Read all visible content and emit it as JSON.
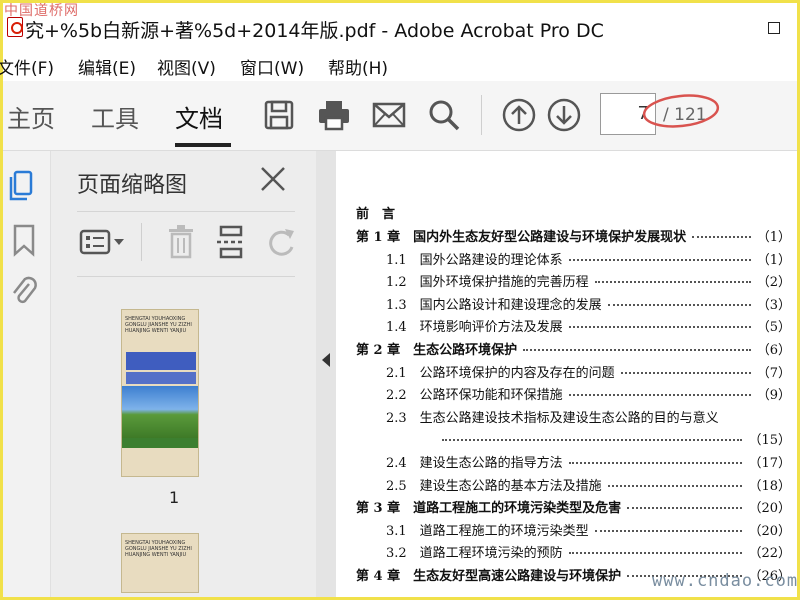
{
  "watermark_top": "中国道桥网",
  "window": {
    "title": "究+%5b白新源+著%5d+2014年版.pdf - Adobe Acrobat Pro DC"
  },
  "menu": {
    "items": [
      "文件(F)",
      "编辑(E)",
      "视图(V)",
      "窗口(W)",
      "帮助(H)"
    ]
  },
  "toolbar": {
    "tabs": [
      "主页",
      "工具",
      "文档"
    ],
    "active_tab": "文档",
    "icons": [
      "save-icon",
      "print-icon",
      "email-icon",
      "search-icon",
      "arrow-up-icon",
      "arrow-down-icon"
    ],
    "page_current": "7",
    "page_total": "/ 121"
  },
  "thumbnail_panel": {
    "title": "页面缩略图",
    "thumb1_text": "SHENGTAI YOUHAOXING GONGLU JIANSHE YU ZIZHI HUANJING WENTI YANJIU",
    "thumb1_title_cn": "生态友好型公路建设与环境保护",
    "thumb1_page": "1",
    "thumb2_text": "SHENGTAI YOUHAOXING GONGLU JIANSHE YU ZIZHI HUANJING WENTI YANJIU"
  },
  "toc": {
    "header": "前　言",
    "entries": [
      {
        "label": "第 1 章　国内外生态友好型公路建设与环境保护发展现状",
        "page": "（1）",
        "bold": true,
        "indent": 0
      },
      {
        "label": "1.1　国外公路建设的理论体系",
        "page": "（1）",
        "bold": false,
        "indent": 1
      },
      {
        "label": "1.2　国外环境保护措施的完善历程",
        "page": "（2）",
        "bold": false,
        "indent": 1
      },
      {
        "label": "1.3　国内公路设计和建设理念的发展",
        "page": "（3）",
        "bold": false,
        "indent": 1
      },
      {
        "label": "1.4　环境影响评价方法及发展",
        "page": "（5）",
        "bold": false,
        "indent": 1
      },
      {
        "label": "第 2 章　生态公路环境保护",
        "page": "（6）",
        "bold": true,
        "indent": 0
      },
      {
        "label": "2.1　公路环境保护的内容及存在的问题",
        "page": "（7）",
        "bold": false,
        "indent": 1
      },
      {
        "label": "2.2　公路环保功能和环保措施",
        "page": "（9）",
        "bold": false,
        "indent": 1
      },
      {
        "label": "2.3　生态公路建设技术指标及建设生态公路的目的与意义",
        "page": "",
        "bold": false,
        "indent": 1
      },
      {
        "label": "",
        "page": "（15）",
        "bold": false,
        "indent": 2
      },
      {
        "label": "2.4　建设生态公路的指导方法",
        "page": "（17）",
        "bold": false,
        "indent": 1
      },
      {
        "label": "2.5　建设生态公路的基本方法及措施",
        "page": "（18）",
        "bold": false,
        "indent": 1
      },
      {
        "label": "第 3 章　道路工程施工的环境污染类型及危害",
        "page": "（20）",
        "bold": true,
        "indent": 0
      },
      {
        "label": "3.1　道路工程施工的环境污染类型",
        "page": "（20）",
        "bold": false,
        "indent": 1
      },
      {
        "label": "3.2　道路工程环境污染的预防",
        "page": "（22）",
        "bold": false,
        "indent": 1
      },
      {
        "label": "第 4 章　生态友好型高速公路建设与环境保护",
        "page": "（26）",
        "bold": true,
        "indent": 0
      }
    ]
  },
  "watermark_bottom": "www.cndao.com"
}
